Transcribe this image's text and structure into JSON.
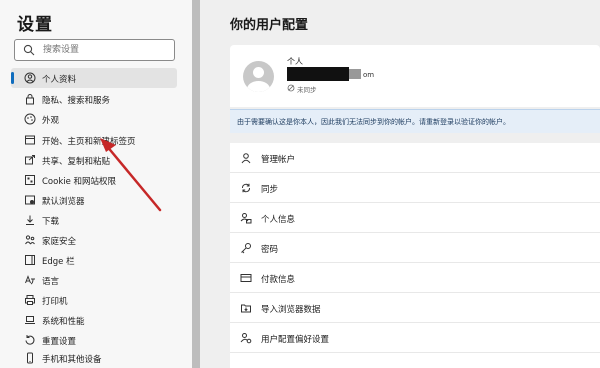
{
  "sidebar": {
    "title": "设置",
    "search": {
      "placeholder": "搜索设置"
    },
    "items": [
      {
        "label": "个人资料",
        "icon": "profile-icon",
        "active": true
      },
      {
        "label": "隐私、搜索和服务",
        "icon": "lock-icon"
      },
      {
        "label": "外观",
        "icon": "appearance-icon"
      },
      {
        "label": "开始、主页和新建标签页",
        "icon": "home-tab-icon"
      },
      {
        "label": "共享、复制和粘贴",
        "icon": "share-icon"
      },
      {
        "label": "Cookie 和网站权限",
        "icon": "cookie-icon"
      },
      {
        "label": "默认浏览器",
        "icon": "browser-icon"
      },
      {
        "label": "下载",
        "icon": "download-icon"
      },
      {
        "label": "家庭安全",
        "icon": "family-icon"
      },
      {
        "label": "Edge 栏",
        "icon": "edge-bar-icon"
      },
      {
        "label": "语言",
        "icon": "language-icon"
      },
      {
        "label": "打印机",
        "icon": "printer-icon"
      },
      {
        "label": "系统和性能",
        "icon": "laptop-icon"
      },
      {
        "label": "重置设置",
        "icon": "reset-icon"
      },
      {
        "label": "手机和其他设备",
        "icon": "phone-icon"
      }
    ]
  },
  "main": {
    "title": "你的用户配置",
    "profile": {
      "name": "个人",
      "email_suffix": "om",
      "status": "未同步"
    },
    "banner": "由于需要确认这是你本人，因此我们无法同步到你的帐户。请重新登录以验证你的帐户。",
    "menu": [
      {
        "label": "管理帐户",
        "icon": "user-icon"
      },
      {
        "label": "同步",
        "icon": "sync-icon"
      },
      {
        "label": "个人信息",
        "icon": "personal-info-icon"
      },
      {
        "label": "密码",
        "icon": "key-icon"
      },
      {
        "label": "付款信息",
        "icon": "card-icon"
      },
      {
        "label": "导入浏览器数据",
        "icon": "import-icon"
      },
      {
        "label": "用户配置偏好设置",
        "icon": "profile-prefs-icon"
      }
    ]
  },
  "colors": {
    "accent": "#0f6cbd",
    "annotation_arrow": "#c62828",
    "banner_bg": "#e5eef8"
  }
}
